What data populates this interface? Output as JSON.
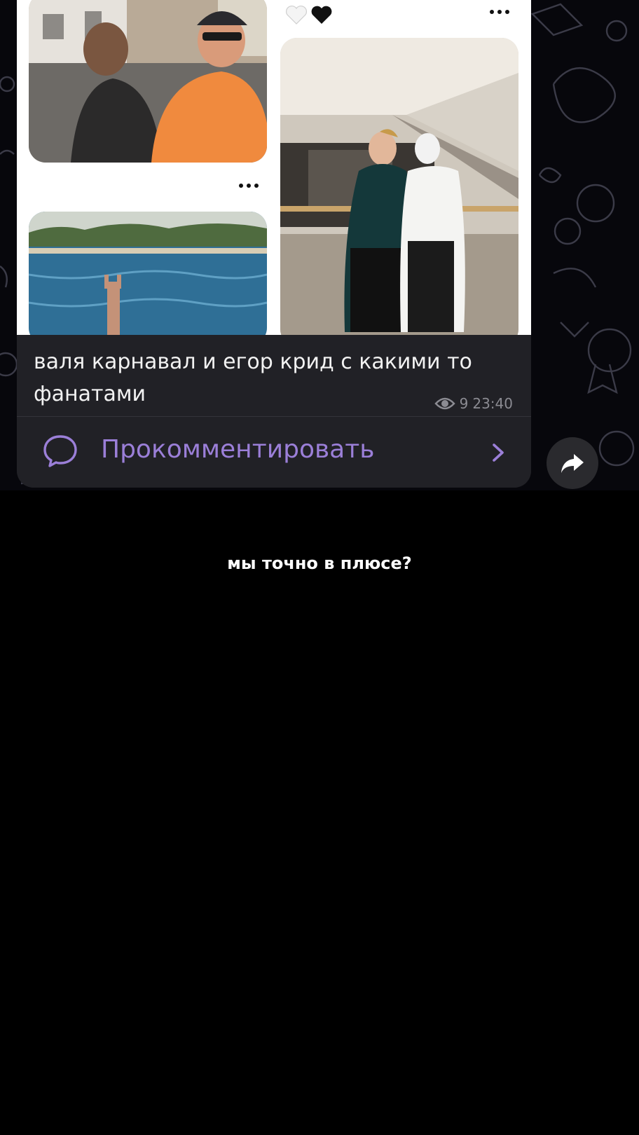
{
  "post": {
    "caption": "валя карнавал и егор крид с какими то фанатами",
    "views": "9",
    "time": "23:40",
    "comment_label": "Прокомментировать"
  },
  "overlay": {
    "bottom_text": "мы точно в плюсе?"
  },
  "colors": {
    "accent": "#9b7fd8",
    "card_bg": "#212126",
    "meta_gray": "#8b8b92",
    "background": "#000000"
  },
  "icons": [
    "heart-white-icon",
    "heart-black-icon",
    "more-dots-icon",
    "eye-icon",
    "comment-bubble-icon",
    "chevron-right-icon",
    "share-arrow-icon"
  ]
}
